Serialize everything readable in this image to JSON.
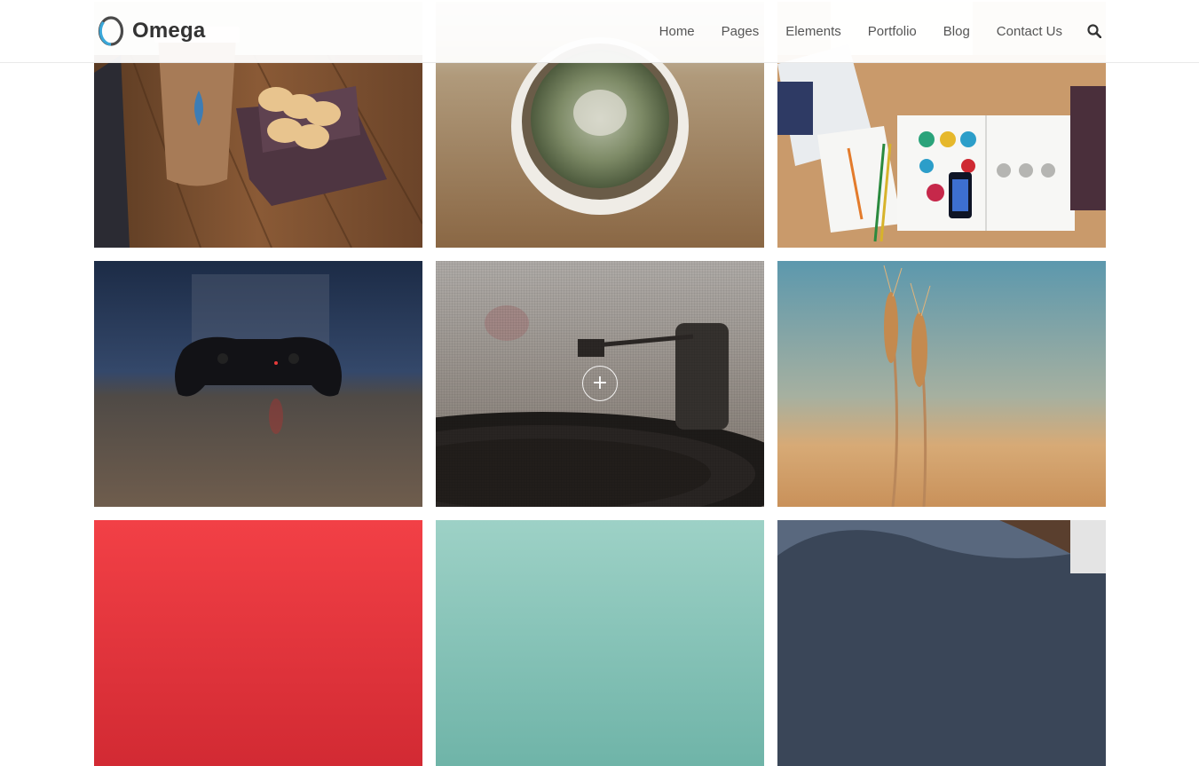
{
  "header": {
    "logo_text": "Omega",
    "nav": [
      {
        "label": "Home"
      },
      {
        "label": "Pages"
      },
      {
        "label": "Elements"
      },
      {
        "label": "Portfolio"
      },
      {
        "label": "Blog"
      },
      {
        "label": "Contact Us"
      }
    ],
    "search_icon": "search-icon"
  },
  "portfolio": {
    "items": [
      {
        "subject": "coffee-macarons",
        "icon": "image"
      },
      {
        "subject": "cactus",
        "icon": "image"
      },
      {
        "subject": "desk-magazine",
        "icon": "image"
      },
      {
        "subject": "game-controller",
        "icon": "image"
      },
      {
        "subject": "record-player",
        "icon": "image",
        "hovered": true,
        "overlay_icon": "plus-icon",
        "overlay_glyph": "+"
      },
      {
        "subject": "wheat",
        "icon": "image"
      },
      {
        "subject": "red",
        "icon": "image"
      },
      {
        "subject": "teal",
        "icon": "image"
      },
      {
        "subject": "denim",
        "icon": "image"
      }
    ]
  },
  "colors": {
    "text_dark": "#333333",
    "nav_text": "#555555",
    "logo_ring_dark": "#4a4a4a",
    "logo_ring_accent": "#3aa7d9"
  }
}
